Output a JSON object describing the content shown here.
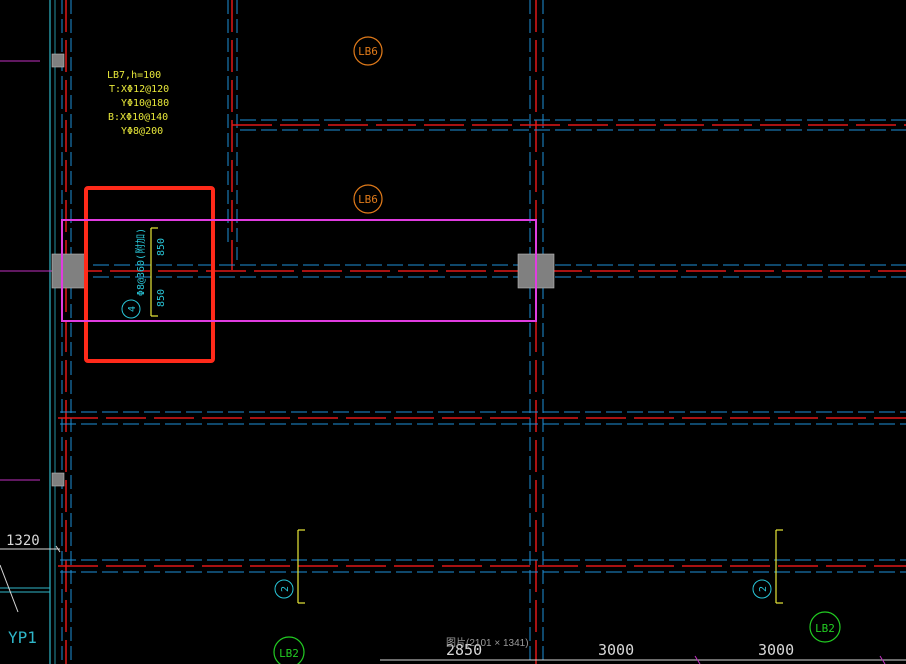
{
  "colors": {
    "background": "#000000",
    "beam_red": "#e01818",
    "beam_dash_blue": "#1e90d8",
    "wall_cyan": "#2fb6c8",
    "note_yellow": "#e8e83a",
    "tag_orange": "#e07a1a",
    "tag_green": "#22cc22",
    "dim_cyan": "#29c6d8",
    "highlight_red": "#ff2a1a",
    "selection_magenta": "#e03ce0",
    "magenta_line": "#c030c0",
    "column_gray": "#808080",
    "dim_white": "#d8d8d8"
  },
  "slab_note": {
    "lines": [
      "LB7,h=100",
      "T:XΦ12@120",
      "YΦ10@180",
      "B:XΦ10@140",
      "YΦ8@200"
    ]
  },
  "slab_tags": {
    "lb6_top": "LB6",
    "lb6_mid": "LB6",
    "lb2_bottom": "LB2",
    "lb2_right": "LB2"
  },
  "rebar_selected": {
    "mark": "4",
    "spec": "Φ8@360(附加)",
    "extent_top": "850",
    "extent_bottom": "850"
  },
  "rebar_lower": {
    "mark_left": "2",
    "mark_right": "2"
  },
  "dimensions": {
    "left_edge": "1320",
    "bottom_1": "2850",
    "bottom_2": "3000",
    "bottom_3": "3000"
  },
  "labels": {
    "yp1": "YP1"
  },
  "status": {
    "image_size": "图片(2101 × 1341)"
  }
}
